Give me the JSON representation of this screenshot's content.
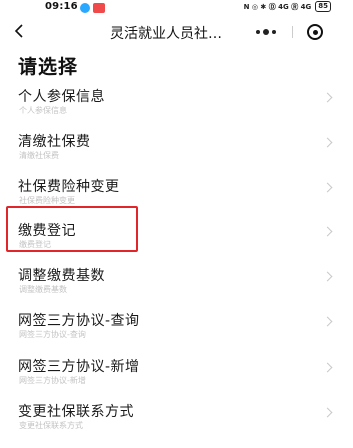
{
  "status_bar": {
    "time": "09:16",
    "right_text": "N ◎ ✱ Ⓓ 4G Ⓡ 4G",
    "battery": "85"
  },
  "nav": {
    "title": "灵活就业人员社…"
  },
  "page": {
    "heading": "请选择"
  },
  "menu": [
    {
      "title": "个人参保信息",
      "subtitle": "个人参保信息"
    },
    {
      "title": "清缴社保费",
      "subtitle": "清缴社保费"
    },
    {
      "title": "社保费险种变更",
      "subtitle": "社保费险种变更"
    },
    {
      "title": "缴费登记",
      "subtitle": "缴费登记"
    },
    {
      "title": "调整缴费基数",
      "subtitle": "调整缴费基数"
    },
    {
      "title": "网签三方协议-查询",
      "subtitle": "网签三方协议-查询"
    },
    {
      "title": "网签三方协议-新增",
      "subtitle": "网签三方协议-新增"
    },
    {
      "title": "变更社保联系方式",
      "subtitle": "变更社保联系方式"
    }
  ],
  "colors": {
    "highlight": "#e0262a",
    "app_dot": "#2aa7ff",
    "notification": "#f04a4a"
  },
  "icons": {
    "back": "back-arrow-icon",
    "more": "more-dots-icon",
    "close": "target-close-icon",
    "chevron": "chevron-right-icon"
  }
}
